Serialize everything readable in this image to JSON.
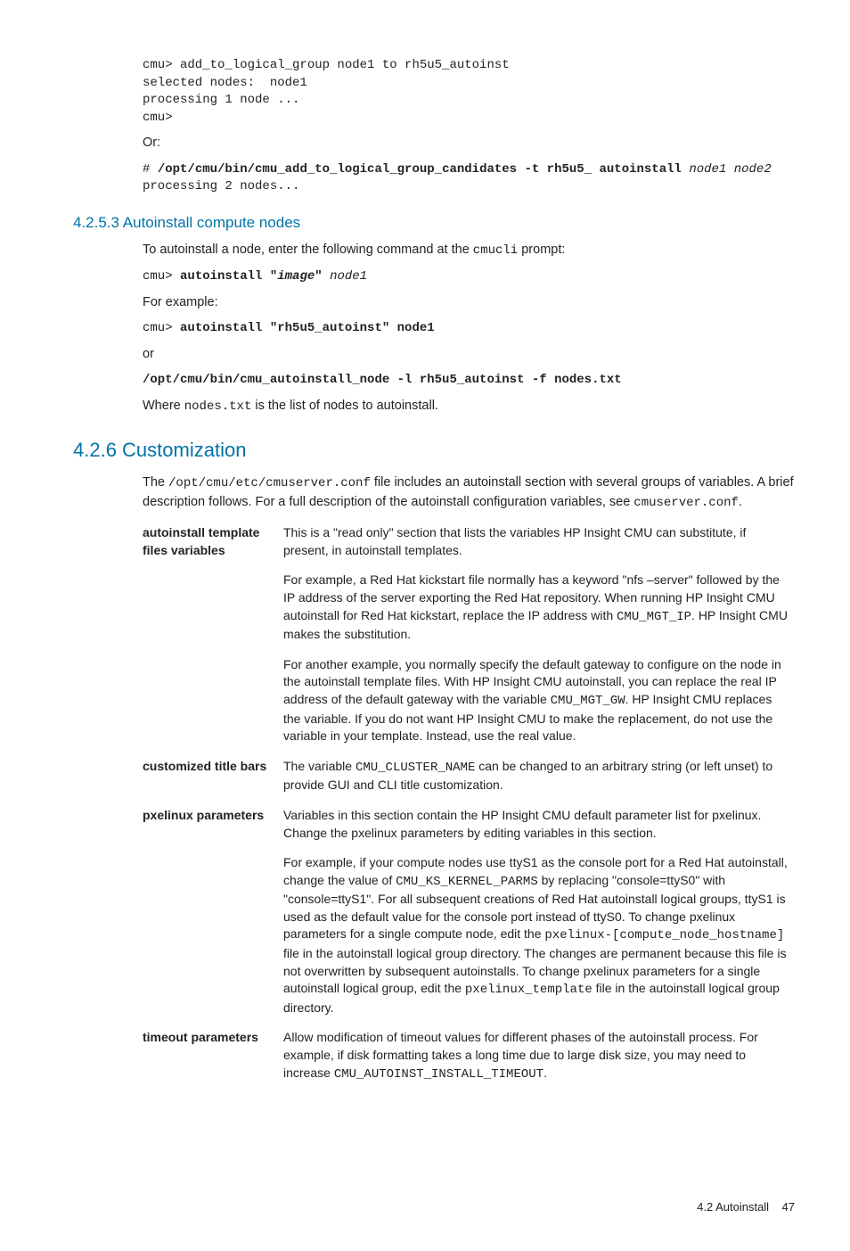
{
  "code_block_1": "cmu> add_to_logical_group node1 to rh5u5_autoinst\nselected nodes:  node1\nprocessing 1 node ...\ncmu>",
  "or_label": "Or:",
  "code_block_2_hash": "# ",
  "code_block_2_cmd": "/opt/cmu/bin/cmu_add_to_logical_group_candidates -t rh5u5_ autoinstall ",
  "code_block_2_args": "node1 node2",
  "code_block_2_out": "processing 2 nodes...",
  "h_4253": "4.2.5.3 Autoinstall compute nodes",
  "p_4253_intro_a": "To autoinstall a node, enter the following command at the ",
  "p_4253_intro_code": "cmucli",
  "p_4253_intro_b": " prompt:",
  "code_4253_1_a": "cmu> ",
  "code_4253_1_b": "autoinstall \"",
  "code_4253_1_c": "image",
  "code_4253_1_d": "\" ",
  "code_4253_1_e": "node1",
  "p_for_example": "For example:",
  "code_4253_2_a": "cmu> ",
  "code_4253_2_b": "autoinstall \"rh5u5_autoinst\" node1",
  "p_or": "or",
  "code_4253_3": "/opt/cmu/bin/cmu_autoinstall_node -l rh5u5_autoinst -f nodes.txt",
  "p_4253_where_a": "Where ",
  "p_4253_where_code": "nodes.txt",
  "p_4253_where_b": " is the list of nodes to autoinstall.",
  "h_426": "4.2.6 Customization",
  "p_426_a": "The ",
  "p_426_code": "/opt/cmu/etc/cmuserver.conf",
  "p_426_b": " file includes an autoinstall section with several groups of variables. A brief description follows. For a full description of the autoinstall configuration variables, see ",
  "p_426_code2": "cmuserver.conf",
  "p_426_c": ".",
  "dl": {
    "autoinstall_term": "autoinstall template files variables",
    "autoinstall_p1": "This is a \"read only\" section that lists the variables HP Insight CMU can substitute, if present, in autoinstall templates.",
    "autoinstall_p2_a": "For example, a Red Hat kickstart file normally has a keyword \"nfs –server\" followed by the IP address of the server exporting the Red Hat repository. When running HP Insight CMU autoinstall for Red Hat kickstart, replace the IP address with ",
    "autoinstall_p2_code": "CMU_MGT_IP",
    "autoinstall_p2_b": ". HP Insight CMU makes the substitution.",
    "autoinstall_p3_a": "For another example, you normally specify the default gateway to configure on the node in the autoinstall template files. With HP Insight CMU autoinstall, you can replace the real IP address of the default gateway with the variable ",
    "autoinstall_p3_code": "CMU_MGT_GW",
    "autoinstall_p3_b": ". HP Insight CMU replaces the variable. If you do not want HP Insight CMU to make the replacement, do not use the variable in your template. Instead, use the real value.",
    "custom_term": "customized title bars",
    "custom_p1_a": "The variable ",
    "custom_p1_code": "CMU_CLUSTER_NAME",
    "custom_p1_b": " can be changed to an arbitrary string (or left unset) to provide GUI and CLI title customization.",
    "pxe_term": "pxelinux parameters",
    "pxe_p1": "Variables in this section contain the HP Insight CMU default parameter list for pxelinux. Change the pxelinux parameters by editing variables in this section.",
    "pxe_p2_a": "For example, if your compute nodes use ttyS1 as the console port for a Red Hat autoinstall, change the value of ",
    "pxe_p2_code1": "CMU_KS_KERNEL_PARMS",
    "pxe_p2_b": " by replacing \"console=ttyS0\" with \"console=ttyS1\". For all subsequent creations of Red Hat autoinstall logical groups, ttyS1 is used as the default value for the console port instead of ttyS0. To change pxelinux parameters for a single compute node, edit the ",
    "pxe_p2_code2": "pxelinux-[compute_node_hostname]",
    "pxe_p2_c": " file in the autoinstall logical group directory. The changes are permanent because this file is not overwritten by subsequent autoinstalls. To change pxelinux parameters for a single autoinstall logical group, edit the ",
    "pxe_p2_code3": "pxelinux_template",
    "pxe_p2_d": " file in the autoinstall logical group directory.",
    "timeout_term": "timeout parameters",
    "timeout_p1_a": "Allow modification of timeout values for different phases of the autoinstall process. For example, if disk formatting takes a long time due to large disk size, you may need to increase ",
    "timeout_p1_code": "CMU_AUTOINST_INSTALL_TIMEOUT",
    "timeout_p1_b": "."
  },
  "footer_section": "4.2 Autoinstall",
  "footer_page": "47"
}
